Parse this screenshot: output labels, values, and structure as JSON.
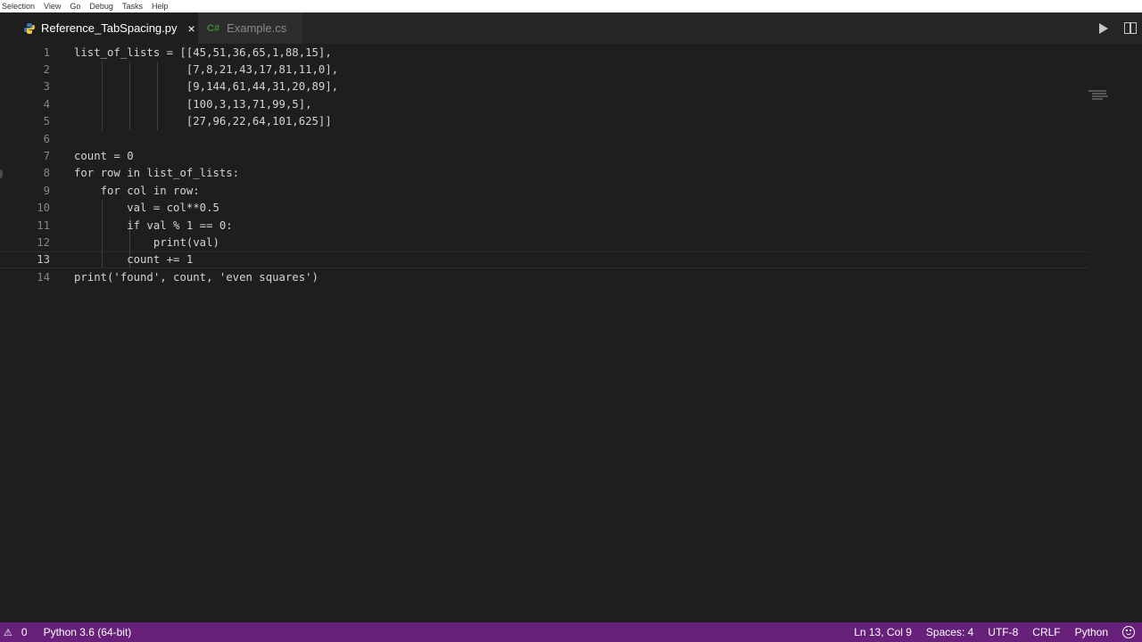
{
  "menu": [
    "Selection",
    "View",
    "Go",
    "Debug",
    "Tasks",
    "Help"
  ],
  "tabs": [
    {
      "label": "Reference_TabSpacing.py",
      "active": true,
      "icon": "python-icon"
    },
    {
      "label": "Example.cs",
      "active": false,
      "icon": "csharp-icon"
    }
  ],
  "tab_close": "×",
  "cs_icon_text": "C#",
  "editor": {
    "current_line": 13,
    "lines": [
      {
        "n": "1",
        "code": "list_of_lists = [[45,51,36,65,1,88,15],"
      },
      {
        "n": "2",
        "code": "                 [7,8,21,43,17,81,11,0],"
      },
      {
        "n": "3",
        "code": "                 [9,144,61,44,31,20,89],"
      },
      {
        "n": "4",
        "code": "                 [100,3,13,71,99,5],"
      },
      {
        "n": "5",
        "code": "                 [27,96,22,64,101,625]]"
      },
      {
        "n": "6",
        "code": ""
      },
      {
        "n": "7",
        "code": "count = 0"
      },
      {
        "n": "8",
        "code": "for row in list_of_lists:"
      },
      {
        "n": "9",
        "code": "    for col in row:"
      },
      {
        "n": "10",
        "code": "        val = col**0.5"
      },
      {
        "n": "11",
        "code": "        if val % 1 == 0:"
      },
      {
        "n": "12",
        "code": "            print(val)"
      },
      {
        "n": "13",
        "code": "        count += 1"
      },
      {
        "n": "14",
        "code": "print('found', count, 'even squares')"
      }
    ]
  },
  "status": {
    "warnings": "0",
    "interpreter": "Python 3.6 (64-bit)",
    "position": "Ln 13, Col 9",
    "spaces": "Spaces: 4",
    "encoding": "UTF-8",
    "eol": "CRLF",
    "language": "Python"
  },
  "colors": {
    "statusbar": "#68217a",
    "editor_bg": "#1e1e1e",
    "tabbar": "#252526"
  }
}
